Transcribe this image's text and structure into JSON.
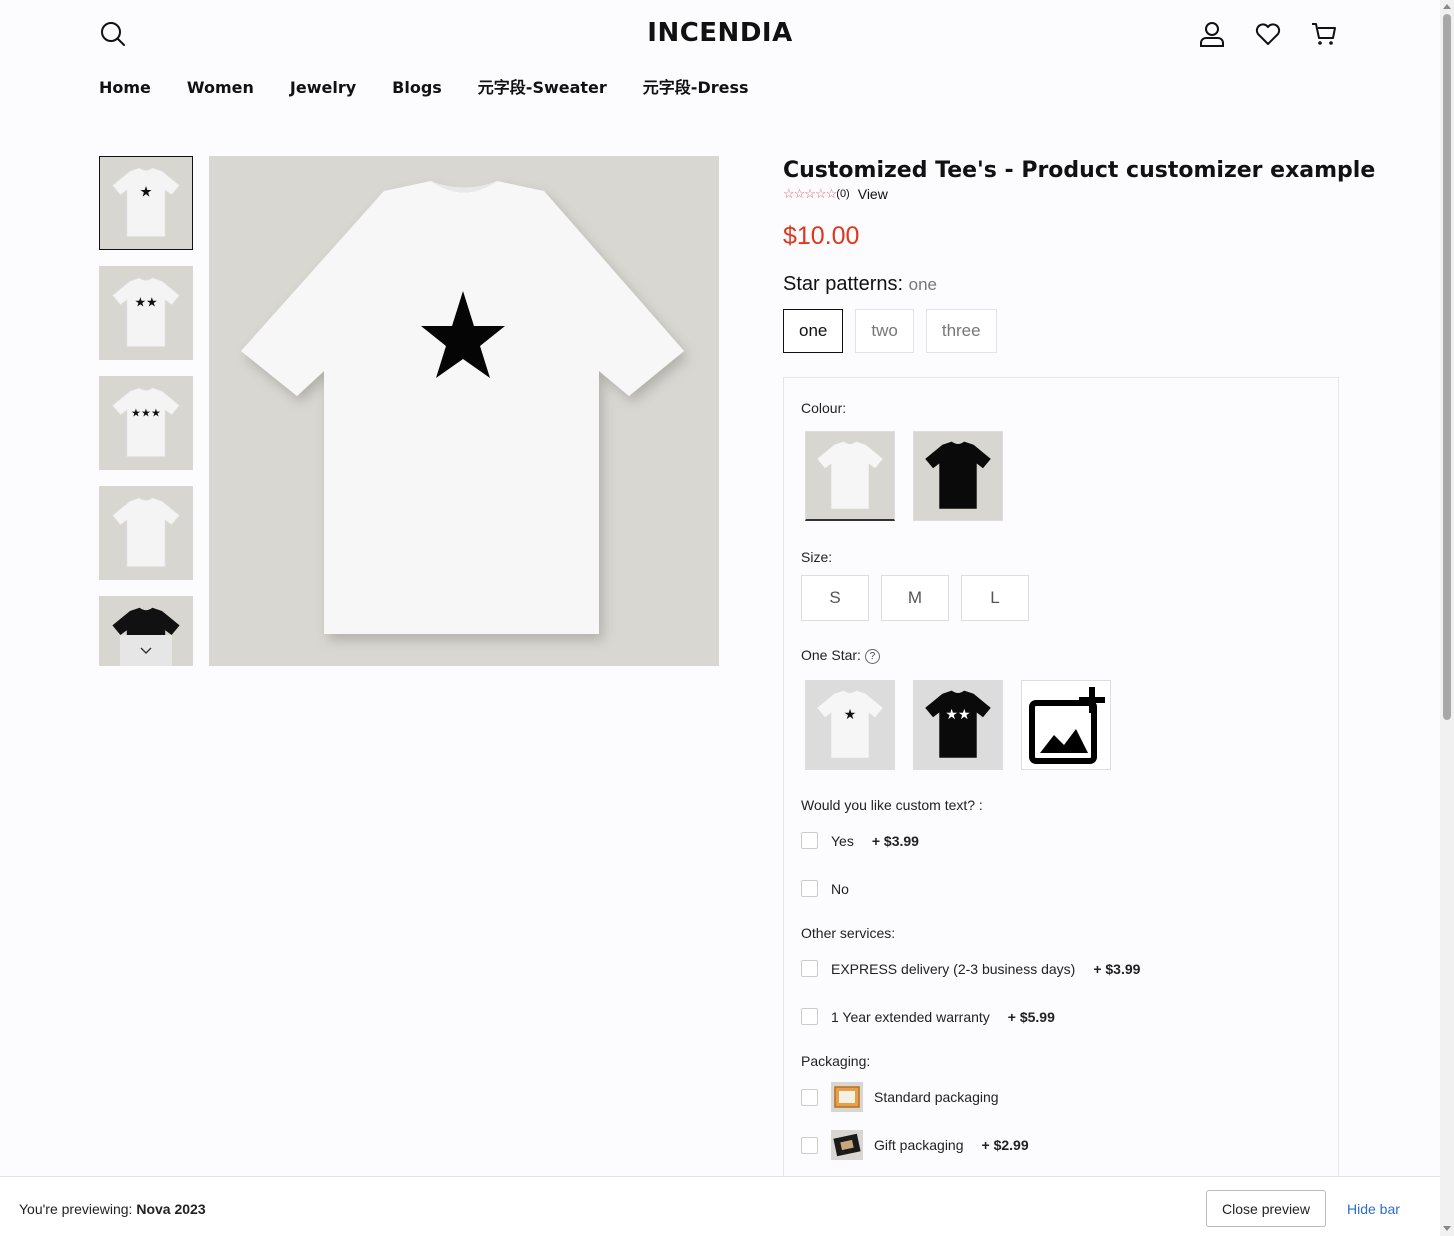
{
  "header": {
    "logo": "INCENDIA",
    "icons": [
      "search-icon",
      "account-icon",
      "wishlist-heart-icon",
      "cart-icon"
    ]
  },
  "nav": [
    "Home",
    "Women",
    "Jewelry",
    "Blogs",
    "元字段-Sweater",
    "元字段-Dress"
  ],
  "gallery": {
    "thumbnails": [
      "one star white tee",
      "two stars white tee",
      "three stars white tee",
      "plain white tee",
      "black tee"
    ]
  },
  "product": {
    "title": "Customized Tee's - Product customizer example",
    "rating_stars": "☆☆☆☆☆",
    "rating_count": "(0)",
    "rating_view": "View",
    "price": "$10.00"
  },
  "star_patterns": {
    "label": "Star patterns:",
    "selected": "one",
    "options": [
      "one",
      "two",
      "three"
    ]
  },
  "customizer": {
    "colour_label": "Colour:",
    "size_label": "Size:",
    "sizes": [
      "S",
      "M",
      "L"
    ],
    "one_star_label": "One Star:",
    "help_glyph": "?",
    "custom_text_label": "Would you like custom text? :",
    "custom_text_options": [
      {
        "label": "Yes",
        "price": "+ $3.99"
      },
      {
        "label": "No",
        "price": ""
      }
    ],
    "other_services_label": "Other services:",
    "services": [
      {
        "label": "EXPRESS delivery (2-3 business days)",
        "price": "+ $3.99"
      },
      {
        "label": "1 Year extended warranty",
        "price": "+ $5.99"
      }
    ],
    "packaging_label": "Packaging:",
    "packaging": [
      {
        "label": "Standard packaging",
        "price": ""
      },
      {
        "label": "Gift packaging",
        "price": "+ $2.99"
      }
    ]
  },
  "preview_bar": {
    "prefix": "You're previewing:",
    "theme": "Nova 2023",
    "close_label": "Close preview",
    "hide_label": "Hide bar"
  },
  "colors": {
    "price": "#e0361c",
    "rating_star": "#e1665b",
    "link": "#2c6ecb"
  }
}
